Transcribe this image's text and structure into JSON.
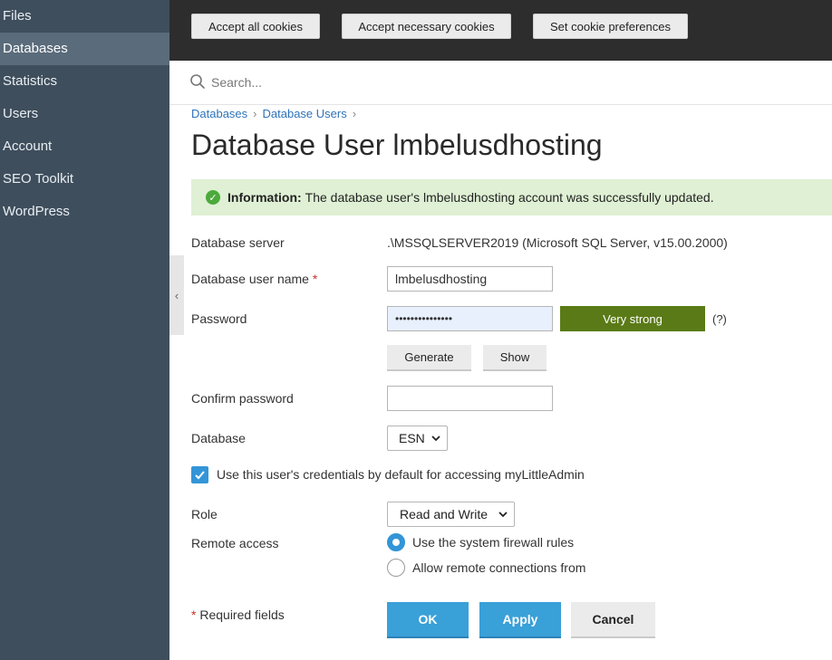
{
  "sidebar": {
    "items": [
      {
        "label": "Files",
        "active": false
      },
      {
        "label": "Databases",
        "active": true
      },
      {
        "label": "Statistics",
        "active": false
      },
      {
        "label": "Users",
        "active": false
      },
      {
        "label": "Account",
        "active": false
      },
      {
        "label": "SEO Toolkit",
        "active": false
      },
      {
        "label": "WordPress",
        "active": false
      }
    ],
    "collapse_icon": "‹"
  },
  "cookie_bar": {
    "accept_all": "Accept all cookies",
    "accept_necessary": "Accept necessary cookies",
    "preferences": "Set cookie preferences"
  },
  "search": {
    "placeholder": "Search..."
  },
  "breadcrumb": {
    "items": [
      "Databases",
      "Database Users"
    ],
    "separator": "›"
  },
  "page_title": "Database User lmbelusdhosting",
  "info": {
    "prefix": "Information:",
    "text": "The database user's lmbelusdhosting account was successfully updated.",
    "icon": "✓"
  },
  "form": {
    "db_server_label": "Database server",
    "db_server_value": ".\\MSSQLSERVER2019 (Microsoft SQL Server, v15.00.2000)",
    "username_label": "Database user name",
    "required_mark": "*",
    "username_value": "lmbelusdhosting",
    "password_label": "Password",
    "password_value": "•••••••••••••••",
    "strength_label": "Very strong",
    "help_label": "(?)",
    "generate_label": "Generate",
    "show_label": "Show",
    "confirm_label": "Confirm password",
    "confirm_value": "",
    "database_label": "Database",
    "database_value": "ESN",
    "credentials_label": "Use this user's credentials by default for accessing myLittleAdmin",
    "credentials_checked": true,
    "role_label": "Role",
    "role_value": "Read and Write",
    "remote_label": "Remote access",
    "remote_options": [
      "Use the system firewall rules",
      "Allow remote connections from"
    ],
    "remote_selected": 0,
    "required_note": "Required fields"
  },
  "actions": {
    "ok": "OK",
    "apply": "Apply",
    "cancel": "Cancel"
  },
  "colors": {
    "sidebar": "#3f4e5c",
    "sidebar_active": "#5a6b7b",
    "primary": "#3aa0d8",
    "strength": "#5a7a17",
    "info_bg": "#dff0d4"
  }
}
